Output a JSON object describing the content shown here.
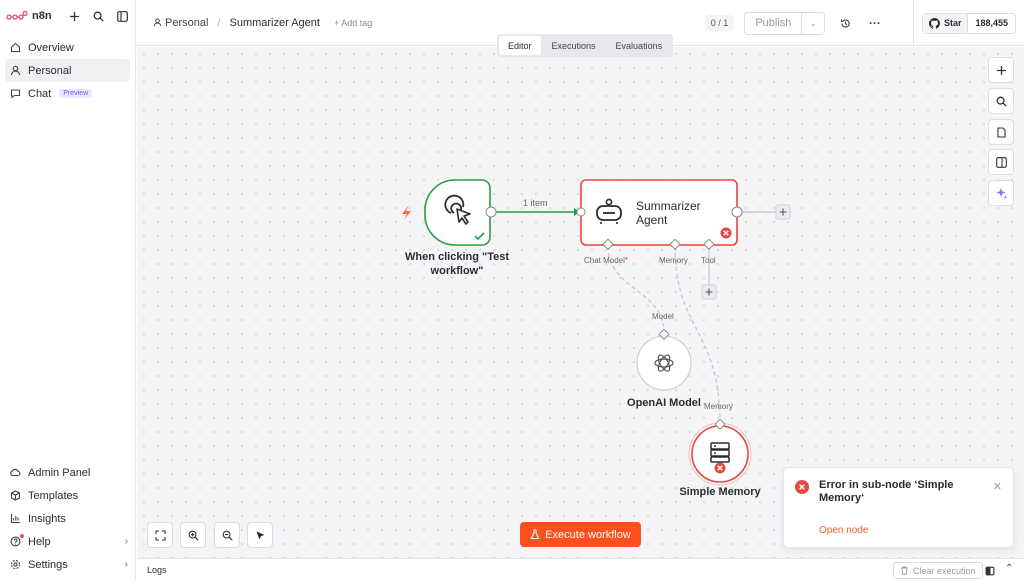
{
  "brand": {
    "name": "n8n",
    "accent": "#ea4b71",
    "orange": "#ff4f1f"
  },
  "sidebar": {
    "items": [
      {
        "label": "Overview",
        "icon": "home-icon"
      },
      {
        "label": "Personal",
        "icon": "user-icon"
      },
      {
        "label": "Chat",
        "icon": "chat-icon",
        "badge": "Preview"
      }
    ],
    "bottom_items": [
      {
        "label": "Admin Panel",
        "icon": "cloud-icon"
      },
      {
        "label": "Templates",
        "icon": "box-icon"
      },
      {
        "label": "Insights",
        "icon": "chart-icon"
      },
      {
        "label": "Help",
        "icon": "help-icon"
      },
      {
        "label": "Settings",
        "icon": "gear-icon"
      }
    ]
  },
  "header": {
    "breadcrumb_project": "Personal",
    "breadcrumb_separator": "/",
    "workflow_name": "Summarizer Agent",
    "add_tag": "+ Add tag",
    "version": "0 / 1",
    "publish_label": "Publish",
    "github_star": "Star",
    "github_count": "188,455"
  },
  "tabs": [
    {
      "label": "Editor",
      "active": true
    },
    {
      "label": "Executions",
      "active": false
    },
    {
      "label": "Evaluations",
      "active": false
    }
  ],
  "nodes": {
    "trigger": {
      "label": "When clicking \"Test workflow\"",
      "status": "success"
    },
    "agent": {
      "label": "Summarizer Agent",
      "status": "error"
    },
    "model": {
      "label": "OpenAI Model"
    },
    "memory": {
      "label": "Simple Memory",
      "status": "error"
    }
  },
  "connections": {
    "main_label": "1 item"
  },
  "ports": {
    "chat_model": "Chat Model",
    "chat_model_required": "*",
    "memory": "Memory",
    "tool": "Tool",
    "model_input": "Model",
    "memory_input": "Memory"
  },
  "execute_button": "Execute workflow",
  "toast": {
    "title": "Error in sub-node ‘Simple Memory‘",
    "link": "Open node"
  },
  "logs": {
    "label": "Logs",
    "clear_execution": "Clear execution"
  }
}
